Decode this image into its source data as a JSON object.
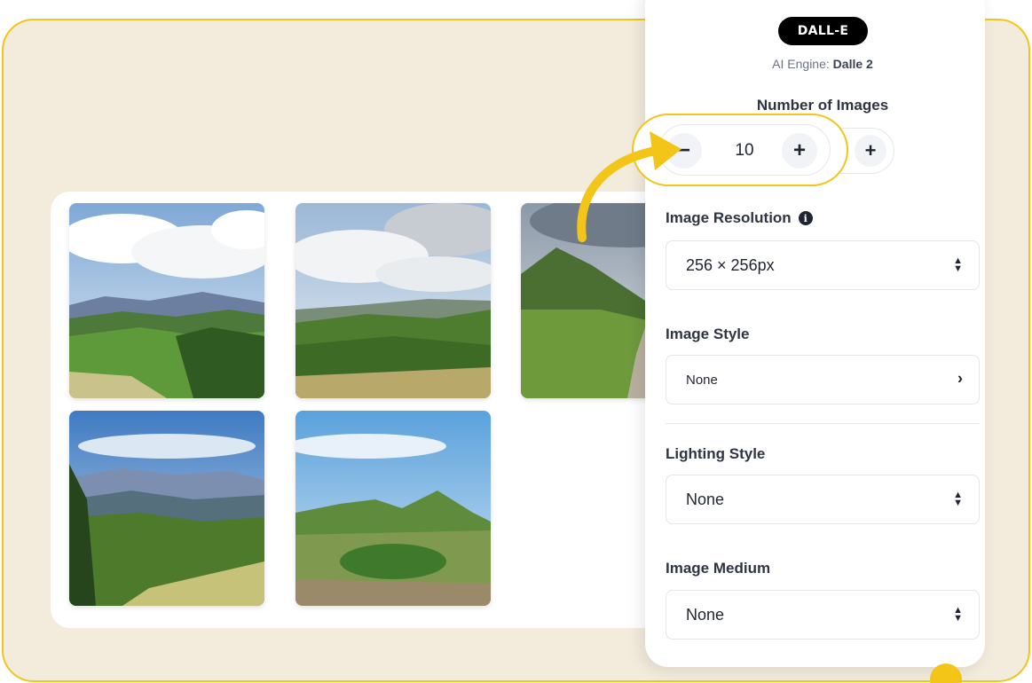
{
  "engine": {
    "badge": "DALL-E",
    "label": "AI Engine:",
    "value": "Dalle 2"
  },
  "number_of_images": {
    "label": "Number of Images",
    "value": "10",
    "minus_icon": "minus-icon",
    "plus_icon": "plus-icon",
    "minus_glyph": "−",
    "plus_glyph": "+"
  },
  "image_resolution": {
    "label": "Image Resolution",
    "value": "256 × 256px",
    "info_glyph": "i"
  },
  "image_style": {
    "label": "Image Style",
    "value": "None",
    "chevron_glyph": "›"
  },
  "lighting_style": {
    "label": "Lighting Style",
    "value": "None"
  },
  "image_medium": {
    "label": "Image Medium",
    "value": "None"
  },
  "gallery": {
    "images": [
      "mountain-landscape-image",
      "mountain-landscape-image",
      "mountain-trail-image",
      "forest-valley-image",
      "green-hill-image"
    ]
  },
  "colors": {
    "accent": "#f2c518",
    "background": "#f3ecdd",
    "badge": "#000000"
  }
}
